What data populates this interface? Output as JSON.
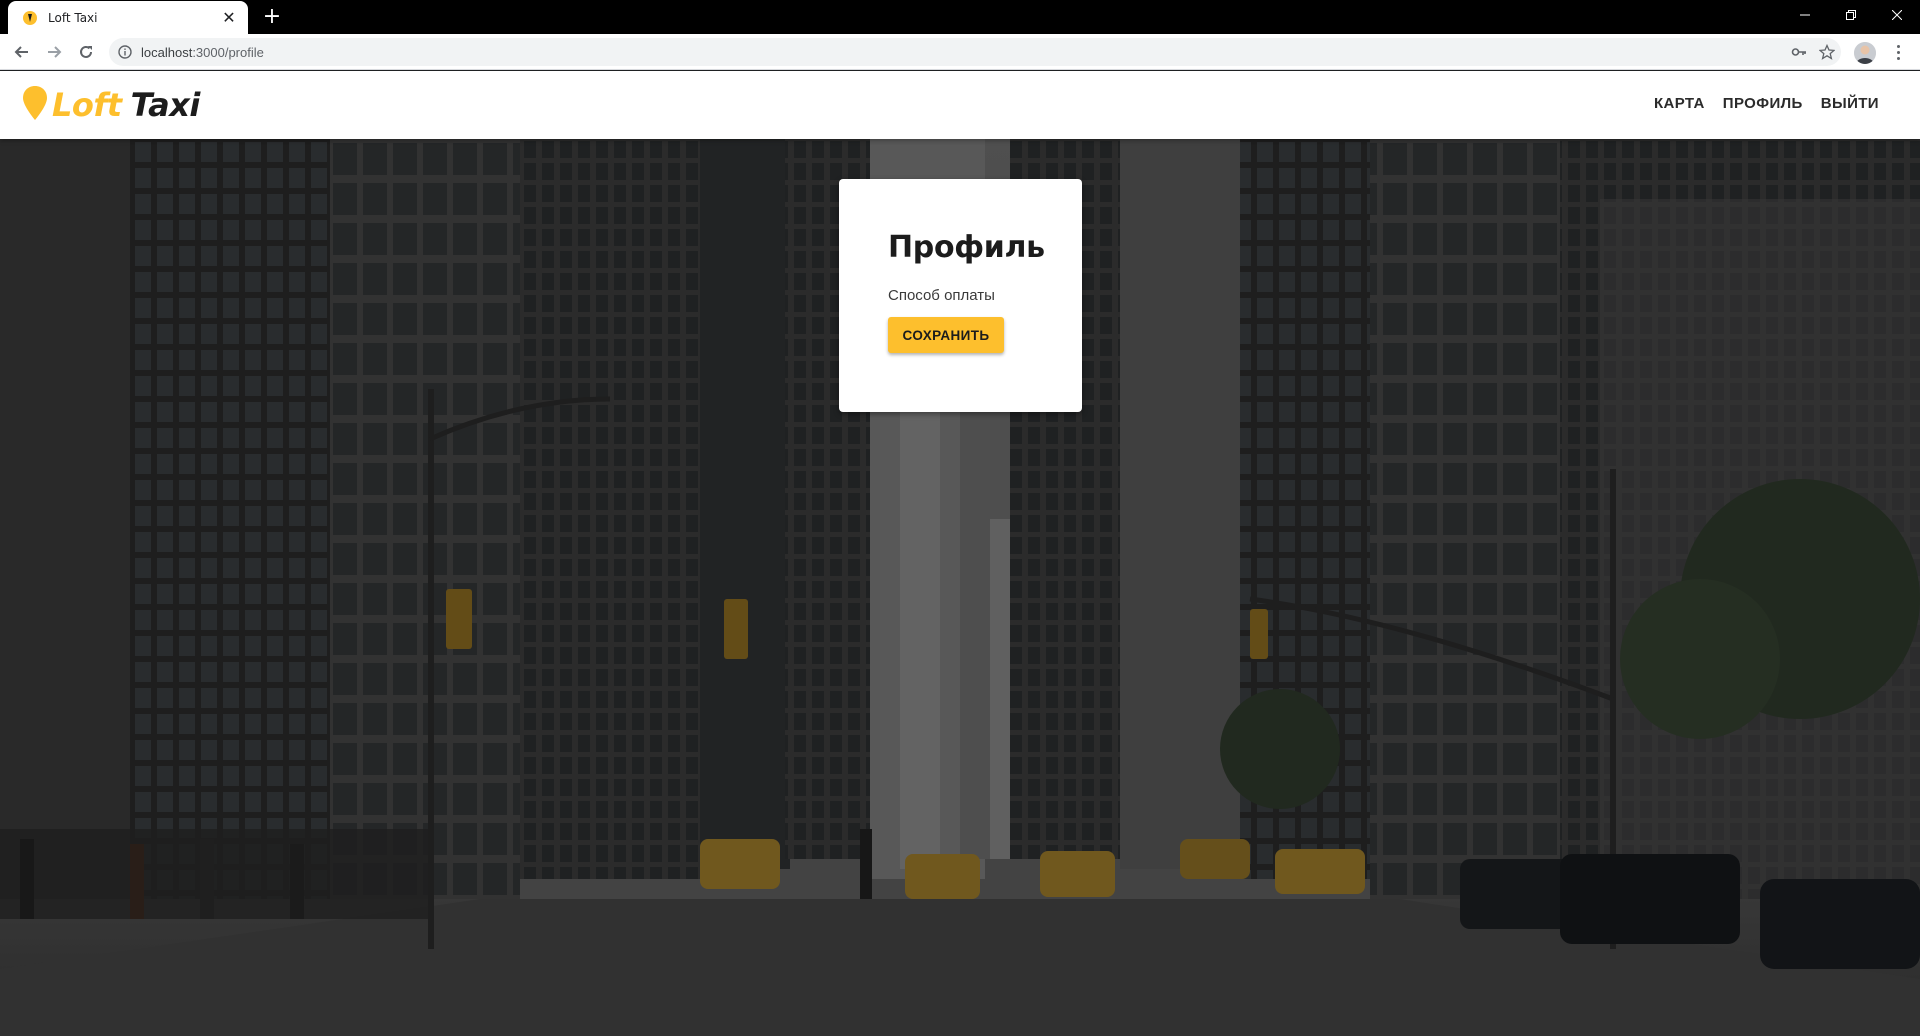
{
  "browser": {
    "tab_title": "Loft Taxi",
    "url_host": "localhost",
    "url_rest": ":3000/profile"
  },
  "app": {
    "logo": {
      "part1": "Loft",
      "part2": "Taxi"
    },
    "nav": [
      {
        "label": "КАРТА"
      },
      {
        "label": "ПРОФИЛЬ"
      },
      {
        "label": "ВЫЙТИ"
      }
    ]
  },
  "profile_card": {
    "title": "Профиль",
    "payment_label": "Способ оплаты",
    "save_label": "СОХРАНИТЬ"
  },
  "colors": {
    "brand_yellow": "#fdbf2d",
    "text_dark": "#1c1c1c"
  },
  "icons": {
    "favicon": "loft-taxi-favicon",
    "back": "arrow-left-icon",
    "forward": "arrow-right-icon",
    "reload": "reload-icon",
    "site_info": "info-icon",
    "password": "key-icon",
    "bookmark": "star-icon"
  }
}
